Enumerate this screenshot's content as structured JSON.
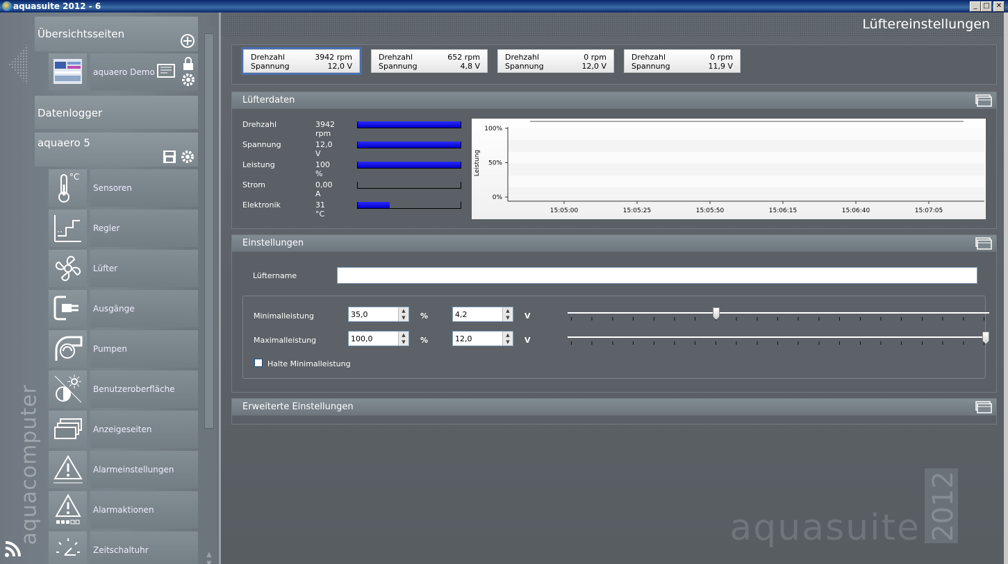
{
  "window": {
    "title": "aquasuite 2012 - 6",
    "controls": [
      "_",
      "□",
      "✕"
    ]
  },
  "sidebar": {
    "brand": "aquacomputer",
    "overview_header": "Übersichtsseiten",
    "overview_item": "aquaero Demo",
    "datalogger_header": "Datenlogger",
    "device_header": "aquaero 5",
    "items": [
      {
        "label": "Sensoren",
        "icon": "thermometer-icon"
      },
      {
        "label": "Regler",
        "icon": "controller-icon"
      },
      {
        "label": "Lüfter",
        "icon": "fan-icon"
      },
      {
        "label": "Ausgänge",
        "icon": "plug-icon"
      },
      {
        "label": "Pumpen",
        "icon": "pump-icon"
      },
      {
        "label": "Benutzeroberfläche",
        "icon": "display-icon"
      },
      {
        "label": "Anzeigeseiten",
        "icon": "pages-icon"
      },
      {
        "label": "Alarmeinstellungen",
        "icon": "alarm-icon"
      },
      {
        "label": "Alarmaktionen",
        "icon": "alarm-action-icon"
      },
      {
        "label": "Zeitschaltuhr",
        "icon": "timer-icon"
      }
    ],
    "thermo_unit": "°C"
  },
  "page": {
    "title": "Lüftereinstellungen"
  },
  "fans": [
    {
      "l1": "Drehzahl",
      "r1": "3942 rpm",
      "l2": "Spannung",
      "r2": "12,0 V",
      "selected": true
    },
    {
      "l1": "Drehzahl",
      "r1": "652 rpm",
      "l2": "Spannung",
      "r2": "4,8 V"
    },
    {
      "l1": "Drehzahl",
      "r1": "0 rpm",
      "l2": "Spannung",
      "r2": "12,0 V"
    },
    {
      "l1": "Drehzahl",
      "r1": "0 rpm",
      "l2": "Spannung",
      "r2": "11,9 V"
    }
  ],
  "fandata": {
    "title": "Lüfterdaten",
    "rows": [
      {
        "label": "Drehzahl",
        "value": "3942 rpm",
        "level": 1.0
      },
      {
        "label": "Spannung",
        "value": "12,0 V",
        "level": 1.0
      },
      {
        "label": "Leistung",
        "value": "100 %",
        "level": 1.0
      },
      {
        "label": "Strom",
        "value": "0,00 A",
        "level": 0.0
      },
      {
        "label": "Elektronik",
        "value": "31 °C",
        "level": 0.31
      }
    ]
  },
  "chart_data": {
    "type": "line",
    "ylabel": "Leistung",
    "yticks": [
      "100%",
      "50%",
      "0%"
    ],
    "ylim": [
      0,
      100
    ],
    "x": [
      "15:05:00",
      "15:05:25",
      "15:05:50",
      "15:06:15",
      "15:06:40",
      "15:07:05"
    ],
    "series": [
      {
        "values": [
          100,
          100,
          100,
          100,
          100,
          100,
          100
        ]
      }
    ],
    "grid": false
  },
  "settings": {
    "title": "Einstellungen",
    "name_label": "Lüftername",
    "name_value": "",
    "min_label": "Minimalleistung",
    "min_percent": "35,0",
    "min_volt": "4,2",
    "min_level": 0.35,
    "max_label": "Maximalleistung",
    "max_percent": "100,0",
    "max_volt": "12,0",
    "max_level": 1.0,
    "percent_unit": "%",
    "volt_unit": "V",
    "hold_label": "Halte Minimalleistung",
    "hold_checked": false
  },
  "advanced": {
    "title": "Erweiterte Einstellungen"
  },
  "watermark": {
    "text": "aquasuite",
    "year": "2012"
  }
}
